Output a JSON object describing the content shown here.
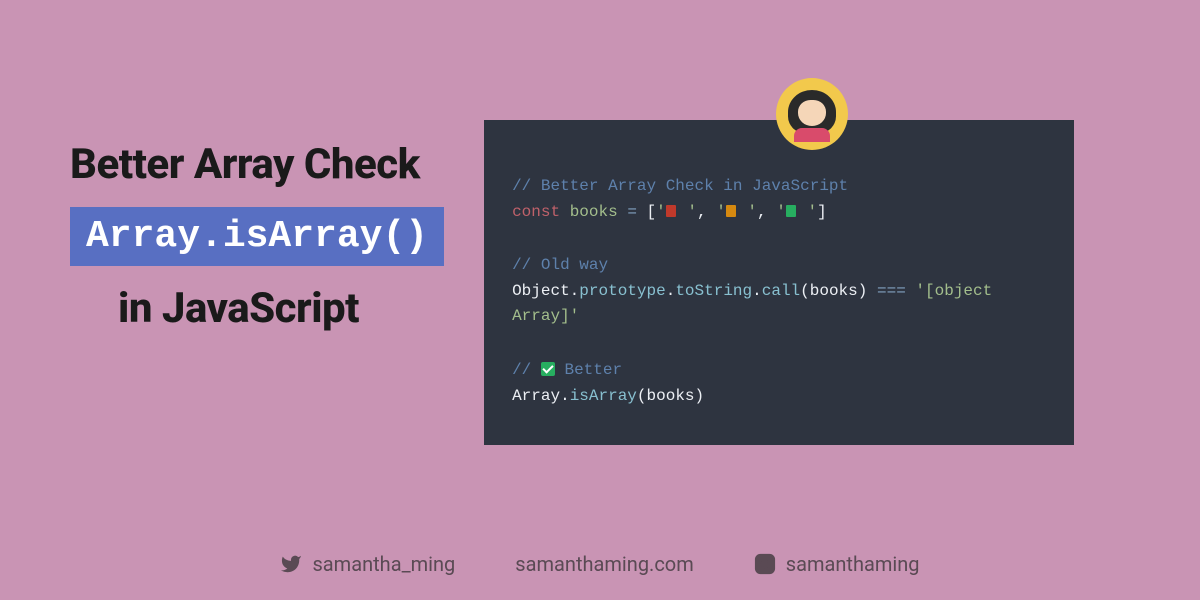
{
  "title": {
    "line1": "Better Array Check",
    "highlight": "Array.isArray()",
    "line3": "in JavaScript"
  },
  "code": {
    "comment1": "// Better Array Check in JavaScript",
    "const": "const",
    "var": "books",
    "eq": "=",
    "lb": "[",
    "q": "'",
    "comma": ",",
    "rb": "]",
    "comment2": "// Old way",
    "obj": "Object",
    "dot": ".",
    "proto": "prototype",
    "tostr": "toString",
    "call": "call",
    "lp": "(",
    "arg": "books",
    "rp": ")",
    "tripeq": "===",
    "strlit": "'[object Array]'",
    "comment3a": "// ",
    "comment3b": " Better",
    "arr": "Array",
    "isarr": "isArray"
  },
  "footer": {
    "twitter": "samantha_ming",
    "site": "samanthaming.com",
    "instagram": "samanthaming"
  }
}
